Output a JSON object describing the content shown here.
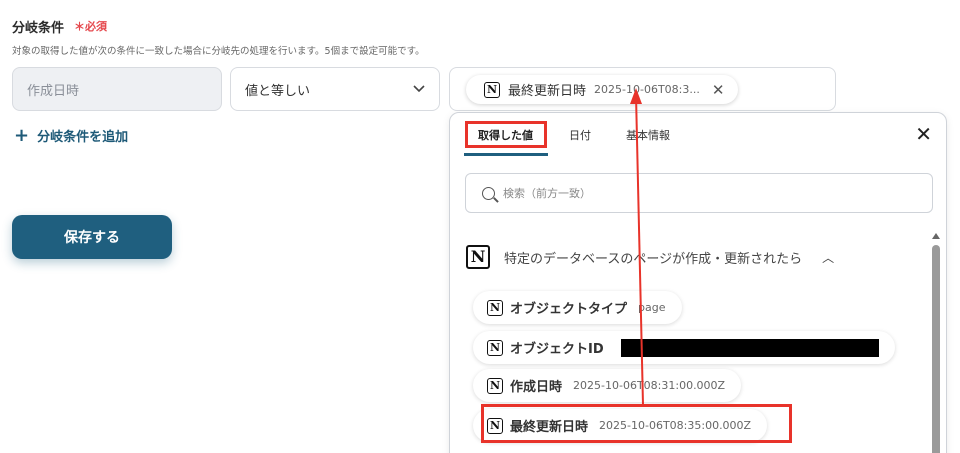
{
  "form": {
    "section_title": "分岐条件",
    "required_label": "＊必須",
    "helper_text": "対象の取得した値が次の条件に一致した場合に分岐先の処理を行います。5個まで設定可能です。",
    "field_name": "作成日時",
    "operator": "値と等しい",
    "value_chip": {
      "icon": "notion-icon",
      "label": "最終更新日時",
      "value": "2025-10-06T08:3..."
    },
    "add_condition_label": "分岐条件を追加",
    "save_label": "保存する"
  },
  "panel": {
    "tabs": [
      "取得した値",
      "日付",
      "基本情報"
    ],
    "active_tab": "取得した値",
    "search_placeholder": "検索（前方一致）",
    "group_title": "特定のデータベースのページが作成・更新されたら",
    "items": [
      {
        "label": "オブジェクトタイプ",
        "value": "page"
      },
      {
        "label": "オブジェクトID",
        "value": ""
      },
      {
        "label": "作成日時",
        "value": "2025-10-06T08:31:00.000Z"
      },
      {
        "label": "最終更新日時",
        "value": "2025-10-06T08:35:00.000Z"
      }
    ]
  },
  "colors": {
    "accent": "#1f5f7f",
    "highlight": "#e8332a",
    "required": "#e5484d"
  }
}
